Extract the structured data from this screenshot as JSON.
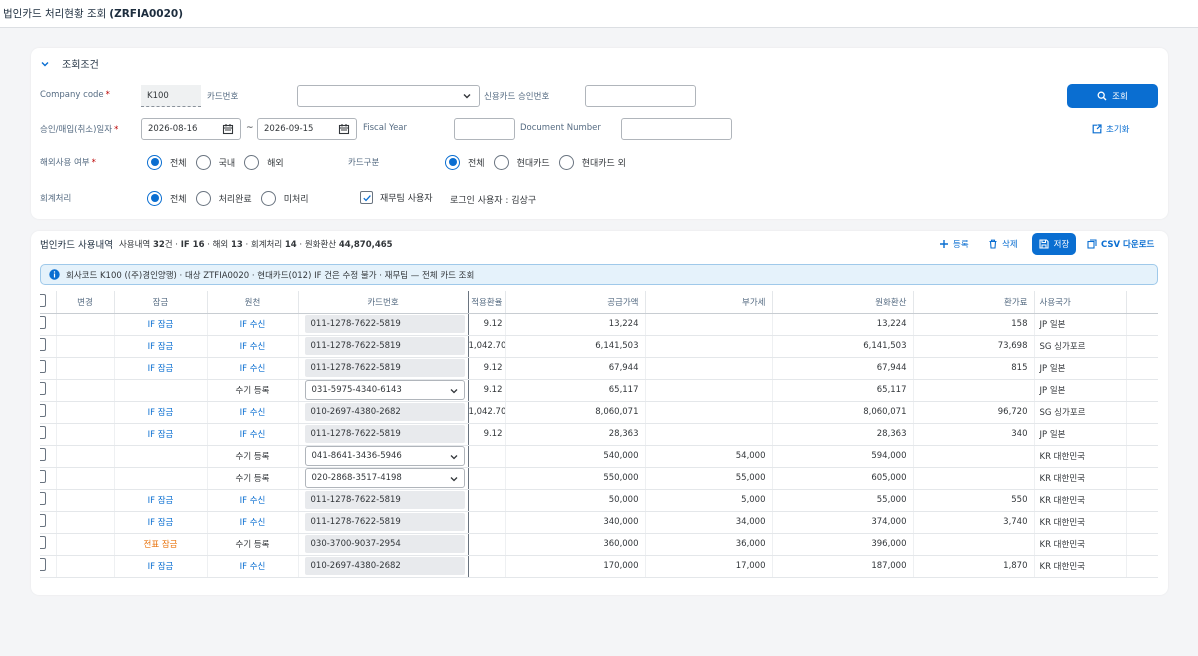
{
  "app": {
    "title_prefix": "법인카드 처리현황 조회",
    "title_code": "(ZRFIA0020)"
  },
  "filter": {
    "section_title": "조회조건",
    "company_code_label": "Company code",
    "company_code_value": "K100",
    "card_no_label": "카드번호",
    "card_no_value": "",
    "credit_approval_label": "신용카드 승인번호",
    "credit_approval_value": "",
    "date_label": "승인/매입(취소)일자",
    "date_from": "2026-08-16",
    "date_tilde": "~",
    "date_to": "2026-09-15",
    "fiscal_year_label": "Fiscal Year",
    "fiscal_year_value": "",
    "doc_number_label": "Document Number",
    "doc_number_value": "",
    "overseas_label": "해외사용 여부",
    "overseas_options": [
      "전체",
      "국내",
      "해외"
    ],
    "overseas_selected": 0,
    "card_type_label": "카드구분",
    "card_type_options": [
      "전체",
      "현대카드",
      "현대카드 외"
    ],
    "card_type_selected": 0,
    "accounting_label": "회계처리",
    "accounting_options": [
      "전체",
      "처리완료",
      "미처리"
    ],
    "accounting_selected": 0,
    "finance_user_label": "재무팀 사용자",
    "finance_user_checked": true,
    "login_user_text": "로그인 사용자 : 김상구",
    "search_button": "조회",
    "reset_button": "초기화"
  },
  "summary": {
    "title": "법인카드 사용내역",
    "text_1": "사용내역 ",
    "count_total": "32",
    "text_2": "건 · ",
    "if_label": "IF ",
    "if_count": "16",
    "text_3": " · 해외 ",
    "overseas_count": "13",
    "text_4": " · 회계처리 ",
    "acc_count": "14",
    "text_5": " · 원화환산 ",
    "krw_total": "44,870,465"
  },
  "toolbar": {
    "register": "등록",
    "delete": "삭제",
    "save": "저장",
    "csv": "CSV 다운로드"
  },
  "info_message": "회사코드 K100 ((주)경인양행) · 대상 ZTFIA0020 · 현대카드(012) IF 건은 수정 불가 · 재무팀 — 전체 카드 조회",
  "table": {
    "columns": [
      "변경",
      "잠금",
      "원천",
      "카드번호",
      "적용환율",
      "공급가액",
      "부가세",
      "원화환산",
      "환가료",
      "사용국가"
    ],
    "rows": [
      {
        "lock": "IF 잠금",
        "lock_type": "if",
        "source": "IF 수신",
        "source_type": "if",
        "card": "011-1278-7622-5819",
        "editable": false,
        "rate": "9.12",
        "supply": "13,224",
        "vat": "",
        "krw": "13,224",
        "fee": "158",
        "country": "JP 일본"
      },
      {
        "lock": "IF 잠금",
        "lock_type": "if",
        "source": "IF 수신",
        "source_type": "if",
        "card": "011-1278-7622-5819",
        "editable": false,
        "rate": "1,042.70",
        "supply": "6,141,503",
        "vat": "",
        "krw": "6,141,503",
        "fee": "73,698",
        "country": "SG 싱가포르"
      },
      {
        "lock": "IF 잠금",
        "lock_type": "if",
        "source": "IF 수신",
        "source_type": "if",
        "card": "011-1278-7622-5819",
        "editable": false,
        "rate": "9.12",
        "supply": "67,944",
        "vat": "",
        "krw": "67,944",
        "fee": "815",
        "country": "JP 일본"
      },
      {
        "lock": "",
        "lock_type": "",
        "source": "수기 등록",
        "source_type": "manual",
        "card": "031-5975-4340-6143",
        "editable": true,
        "rate": "9.12",
        "supply": "65,117",
        "vat": "",
        "krw": "65,117",
        "fee": "",
        "country": "JP 일본"
      },
      {
        "lock": "IF 잠금",
        "lock_type": "if",
        "source": "IF 수신",
        "source_type": "if",
        "card": "010-2697-4380-2682",
        "editable": false,
        "rate": "1,042.70",
        "supply": "8,060,071",
        "vat": "",
        "krw": "8,060,071",
        "fee": "96,720",
        "country": "SG 싱가포르"
      },
      {
        "lock": "IF 잠금",
        "lock_type": "if",
        "source": "IF 수신",
        "source_type": "if",
        "card": "011-1278-7622-5819",
        "editable": false,
        "rate": "9.12",
        "supply": "28,363",
        "vat": "",
        "krw": "28,363",
        "fee": "340",
        "country": "JP 일본"
      },
      {
        "lock": "",
        "lock_type": "",
        "source": "수기 등록",
        "source_type": "manual",
        "card": "041-8641-3436-5946",
        "editable": true,
        "rate": "",
        "supply": "540,000",
        "vat": "54,000",
        "krw": "594,000",
        "fee": "",
        "country": "KR 대한민국"
      },
      {
        "lock": "",
        "lock_type": "",
        "source": "수기 등록",
        "source_type": "manual",
        "card": "020-2868-3517-4198",
        "editable": true,
        "rate": "",
        "supply": "550,000",
        "vat": "55,000",
        "krw": "605,000",
        "fee": "",
        "country": "KR 대한민국"
      },
      {
        "lock": "IF 잠금",
        "lock_type": "if",
        "source": "IF 수신",
        "source_type": "if",
        "card": "011-1278-7622-5819",
        "editable": false,
        "rate": "",
        "supply": "50,000",
        "vat": "5,000",
        "krw": "55,000",
        "fee": "550",
        "country": "KR 대한민국"
      },
      {
        "lock": "IF 잠금",
        "lock_type": "if",
        "source": "IF 수신",
        "source_type": "if",
        "card": "011-1278-7622-5819",
        "editable": false,
        "rate": "",
        "supply": "340,000",
        "vat": "34,000",
        "krw": "374,000",
        "fee": "3,740",
        "country": "KR 대한민국"
      },
      {
        "lock": "전표 잠금",
        "lock_type": "doc",
        "source": "수기 등록",
        "source_type": "manual",
        "card": "030-3700-9037-2954",
        "editable": false,
        "rate": "",
        "supply": "360,000",
        "vat": "36,000",
        "krw": "396,000",
        "fee": "",
        "country": "KR 대한민국"
      },
      {
        "lock": "IF 잠금",
        "lock_type": "if",
        "source": "IF 수신",
        "source_type": "if",
        "card": "010-2697-4380-2682",
        "editable": false,
        "rate": "",
        "supply": "170,000",
        "vat": "17,000",
        "krw": "187,000",
        "fee": "1,870",
        "country": "KR 대한민국"
      }
    ]
  },
  "colors": {
    "accent": "#0a6ed1",
    "lock_doc": "#e9730c",
    "required": "#bb0000"
  }
}
